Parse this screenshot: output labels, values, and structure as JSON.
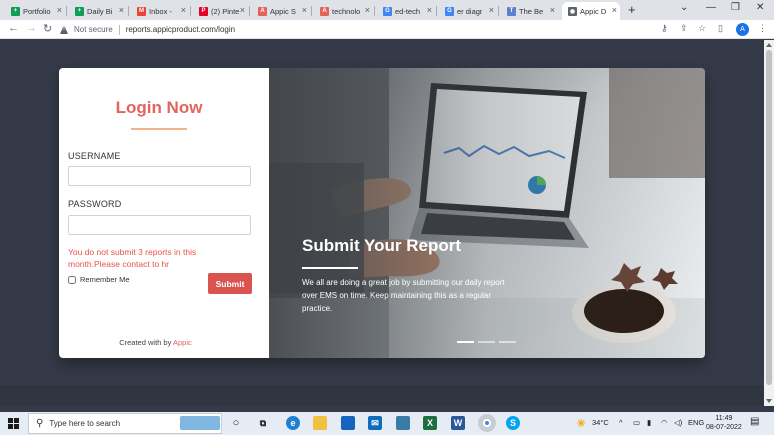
{
  "tabs": [
    {
      "label": "Portfolio",
      "favicon": "sheets-icon",
      "color": "#0f9d58",
      "glyph": "+"
    },
    {
      "label": "Daily Bi",
      "favicon": "sheets-icon",
      "color": "#0f9d58",
      "glyph": "+"
    },
    {
      "label": "Inbox -",
      "favicon": "gmail-icon",
      "color": "#ea4335",
      "glyph": "M"
    },
    {
      "label": "(2) Pinte",
      "favicon": "pinterest-icon",
      "color": "#e60023",
      "glyph": "P"
    },
    {
      "label": "Appic S",
      "favicon": "appic-icon",
      "color": "#e2655b",
      "glyph": "A"
    },
    {
      "label": "technolo",
      "favicon": "appic-icon",
      "color": "#e2655b",
      "glyph": "A"
    },
    {
      "label": "ed-tech",
      "favicon": "google-icon",
      "color": "#4285f4",
      "glyph": "G"
    },
    {
      "label": "er diagr",
      "favicon": "google-icon",
      "color": "#4285f4",
      "glyph": "G"
    },
    {
      "label": "The Be",
      "favicon": "site-icon",
      "color": "#5b7fd1",
      "glyph": "T"
    },
    {
      "label": "Appic D",
      "favicon": "globe-icon",
      "color": "#5f6368",
      "glyph": "◉",
      "active": true
    }
  ],
  "browser": {
    "security": "Not secure",
    "url": "reports.appicproduct.com/login",
    "profile_initial": "A"
  },
  "login": {
    "title": "Login Now",
    "username_label": "USERNAME",
    "password_label": "PASSWORD",
    "username_value": "",
    "password_value": "",
    "error": "You do not submit 3 reports in this month.Please contact to hr",
    "remember_label": "Remember Me",
    "submit_label": "Submit",
    "footer_prefix": "Created with by",
    "footer_brand": "Appic"
  },
  "hero": {
    "title": "Submit Your Report",
    "body": "We all are doing a great job by submitting our daily report over EMS on time. Keep maintaining this as a regular practice.",
    "slides": 3,
    "active_slide": 0
  },
  "taskbar": {
    "search_placeholder": "Type here to search",
    "weather": "34°C",
    "language": "ENG",
    "time": "11:49",
    "date": "08-07-2022"
  }
}
